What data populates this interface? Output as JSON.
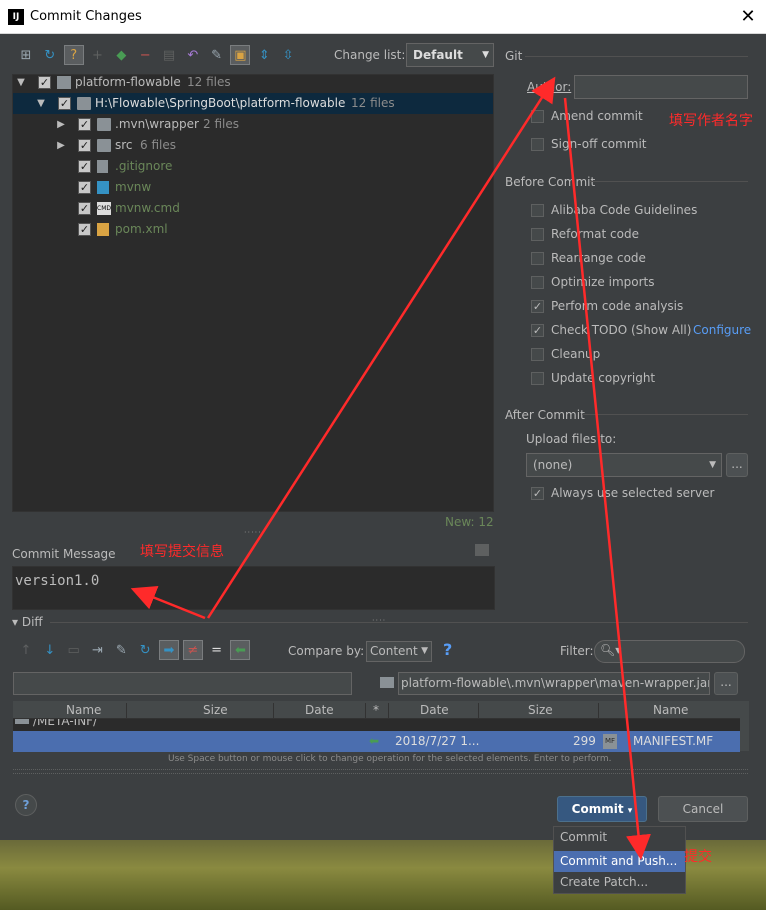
{
  "window": {
    "title": "Commit Changes",
    "close": "✕",
    "app_icon": "IJ"
  },
  "toolbar": {
    "change_list_label": "Change list:",
    "change_list_value": "Default"
  },
  "tree": {
    "rows": [
      {
        "label": "platform-flowable",
        "count": "12 files"
      },
      {
        "label": "H:\\Flowable\\SpringBoot\\platform-flowable",
        "count": "12 files"
      },
      {
        "label": ".mvn\\wrapper",
        "count": "2 files"
      },
      {
        "label": "src",
        "count": "6 files"
      },
      {
        "label": ".gitignore",
        "count": ""
      },
      {
        "label": "mvnw",
        "count": ""
      },
      {
        "label": "mvnw.cmd",
        "count": ""
      },
      {
        "label": "pom.xml",
        "count": ""
      }
    ],
    "new_count": "New: 12"
  },
  "git": {
    "section": "Git",
    "author_label": "Author:",
    "author_value": "",
    "amend": "Amend commit",
    "signoff": "Sign-off commit"
  },
  "before_commit": {
    "section": "Before Commit",
    "options": [
      {
        "label": "Alibaba Code Guidelines",
        "checked": false
      },
      {
        "label": "Reformat code",
        "checked": false
      },
      {
        "label": "Rearrange code",
        "checked": false
      },
      {
        "label": "Optimize imports",
        "checked": false
      },
      {
        "label": "Perform code analysis",
        "checked": true
      },
      {
        "label": "Check TODO (Show All)",
        "checked": true
      },
      {
        "label": "Cleanup",
        "checked": false
      },
      {
        "label": "Update copyright",
        "checked": false
      }
    ],
    "configure_link": "Configure"
  },
  "after_commit": {
    "section": "After Commit",
    "upload_label": "Upload files to:",
    "upload_value": "(none)",
    "always_use": "Always use selected server"
  },
  "commit_message": {
    "label": "Commit Message",
    "value": "version1.0"
  },
  "diff": {
    "section": "Diff",
    "compare_label": "Compare by:",
    "compare_value": "Content",
    "filter_label": "Filter:",
    "path": "platform-flowable\\.mvn\\wrapper\\maven-wrapper.jar",
    "columns_left": [
      "Name",
      "Size",
      "Date"
    ],
    "columns_right": [
      "*",
      "Date",
      "Size",
      "Name"
    ],
    "row_folder": "/META-INF/",
    "row_date": "2018/7/27 1...",
    "row_size": "299",
    "row_name": "MANIFEST.MF",
    "row_name_badge": "MF",
    "hint": "Use Space button or mouse click to change operation for the selected elements. Enter to perform."
  },
  "buttons": {
    "help": "?",
    "commit": "Commit",
    "cancel": "Cancel"
  },
  "popup": {
    "items": [
      "Commit",
      "Commit and Push...",
      "Create Patch..."
    ]
  },
  "annotations": {
    "author_note": "填写作者名字",
    "message_note": "填写提交信息",
    "commit_note": "提交"
  },
  "colors": {
    "background": "#3c3f41",
    "selection": "#0d293e",
    "annotation": "#ff2a2a",
    "primary_button": "#365880",
    "popup_highlight": "#4b6eaf"
  }
}
